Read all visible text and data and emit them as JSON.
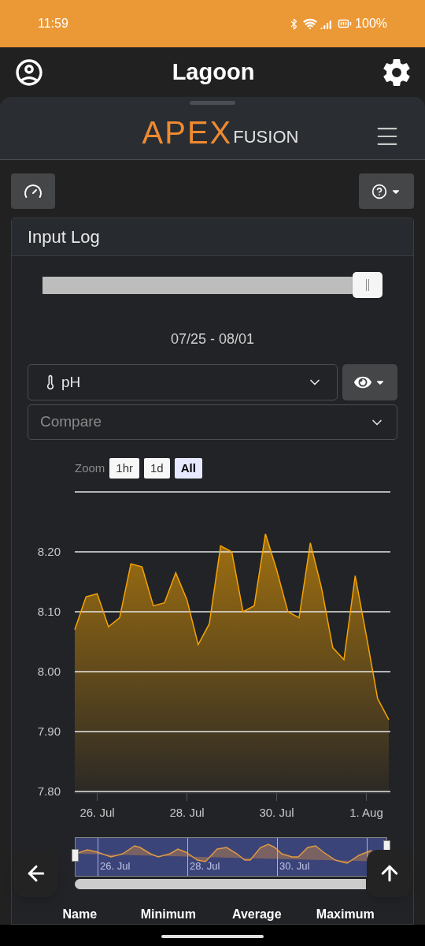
{
  "status_bar": {
    "time": "11:59",
    "battery": "100%"
  },
  "app_bar": {
    "title": "Lagoon"
  },
  "brand": {
    "logo_main": "APEX",
    "logo_sub": "FUSION"
  },
  "card": {
    "title": "Input Log",
    "range_slider": {
      "level": 1
    },
    "date_range": "07/25 - 08/01",
    "input_select": {
      "value": "pH"
    },
    "compare_select": {
      "placeholder": "Compare"
    },
    "zoom": {
      "label": "Zoom",
      "options": [
        {
          "label": "1hr",
          "selected": false
        },
        {
          "label": "1d",
          "selected": false
        },
        {
          "label": "All",
          "selected": true
        }
      ]
    },
    "chart_data": {
      "type": "area",
      "grid": true,
      "ylim": [
        7.8,
        8.3
      ],
      "categories": [
        null,
        null,
        "26. Jul",
        null,
        null,
        null,
        null,
        null,
        null,
        null,
        "28. Jul",
        null,
        null,
        null,
        null,
        null,
        null,
        null,
        "30. Jul",
        null,
        null,
        null,
        null,
        null,
        null,
        null,
        "1. Aug",
        null,
        null
      ],
      "yticks": [
        {
          "value": 7.8,
          "label": "7.80"
        },
        {
          "value": 7.9,
          "label": "7.90"
        },
        {
          "value": 8.0,
          "label": "8.00"
        },
        {
          "value": 8.1,
          "label": "8.10"
        },
        {
          "value": 8.2,
          "label": "8.20"
        }
      ],
      "series": [
        {
          "color": "#f5a300",
          "values": [
            8.07,
            8.125,
            8.13,
            8.075,
            8.09,
            8.18,
            8.175,
            8.11,
            8.115,
            8.165,
            8.12,
            8.045,
            8.08,
            8.21,
            8.2,
            8.1,
            8.11,
            8.23,
            8.17,
            8.1,
            8.09,
            8.215,
            8.14,
            8.04,
            8.02,
            8.16,
            8.06,
            7.955,
            7.92
          ]
        }
      ]
    },
    "navigator": {
      "labels": [
        "26. Jul",
        "28. Jul",
        "30. Jul"
      ]
    },
    "stats_columns": [
      "Name",
      "Minimum",
      "Average",
      "Maximum"
    ]
  }
}
